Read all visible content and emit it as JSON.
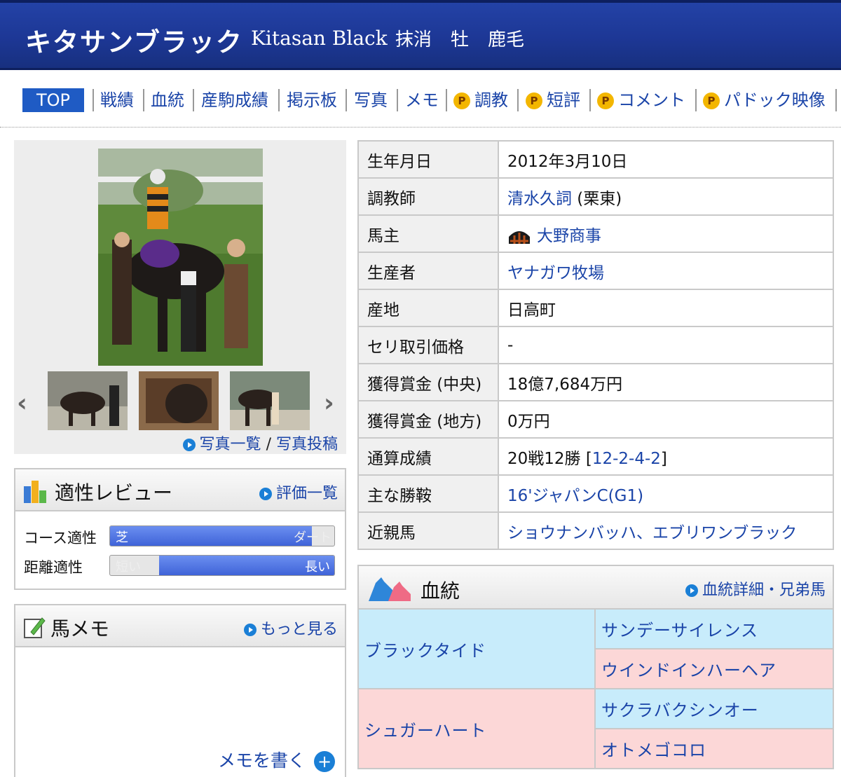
{
  "header": {
    "name_ja": "キタサンブラック",
    "name_en": "Kitasan Black",
    "status": "抹消",
    "sex": "牡",
    "color": "鹿毛"
  },
  "tabs": [
    {
      "label": "TOP",
      "premium": false
    },
    {
      "label": "戦績",
      "premium": false
    },
    {
      "label": "血統",
      "premium": false
    },
    {
      "label": "産駒成績",
      "premium": false
    },
    {
      "label": "掲示板",
      "premium": false
    },
    {
      "label": "写真",
      "premium": false
    },
    {
      "label": "メモ",
      "premium": false
    },
    {
      "label": "調教",
      "premium": true
    },
    {
      "label": "短評",
      "premium": true
    },
    {
      "label": "コメント",
      "premium": true
    },
    {
      "label": "パドック映像",
      "premium": true
    }
  ],
  "premium_badge": "P",
  "photos": {
    "links": {
      "list": "写真一覧",
      "separator": "/",
      "post": "写真投稿"
    },
    "prev_arrow": "‹",
    "next_arrow": "›"
  },
  "aptitude": {
    "title": "適性レビュー",
    "link": "評価一覧",
    "rows": [
      {
        "label": "コース適性",
        "left": "芝",
        "right": "ダート",
        "level": 0.9
      },
      {
        "label": "距離適性",
        "left": "短い",
        "right": "長い",
        "level": 0.78
      }
    ]
  },
  "memo": {
    "title": "馬メモ",
    "link": "もっと見る",
    "write": "メモを書く"
  },
  "info": {
    "rows": [
      {
        "key": "生年月日",
        "value": "2012年3月10日"
      },
      {
        "key": "調教師",
        "link": "清水久詞",
        "value": " (栗東)"
      },
      {
        "key": "馬主",
        "link": "大野商事"
      },
      {
        "key": "生産者",
        "link": "ヤナガワ牧場"
      },
      {
        "key": "産地",
        "value": "日高町"
      },
      {
        "key": "セリ取引価格",
        "value": "-"
      },
      {
        "key": "獲得賞金 (中央)",
        "value": "18億7,684万円"
      },
      {
        "key": "獲得賞金 (地方)",
        "value": "0万円"
      },
      {
        "key": "通算成績",
        "value": "20戦12勝 [",
        "link": "12-2-4-2",
        "suffix": "]"
      },
      {
        "key": "主な勝鞍",
        "link": "16'ジャパンC(G1)"
      },
      {
        "key": "近親馬",
        "link": "ショウナンバッハ、エブリワンブラック"
      }
    ]
  },
  "pedigree": {
    "title": "血統",
    "link": "血統詳細・兄弟馬",
    "sire": "ブラックタイド",
    "dam": "シュガーハート",
    "sire_sire": "サンデーサイレンス",
    "sire_dam": "ウインドインハーヘア",
    "dam_sire": "サクラバクシンオー",
    "dam_dam": "オトメゴコロ"
  },
  "colors": {
    "header": "#1d3795",
    "link": "#1a44a8",
    "tab_active": "#1f5bc4",
    "male": "#c8ecfb",
    "female": "#fcd7d7"
  }
}
